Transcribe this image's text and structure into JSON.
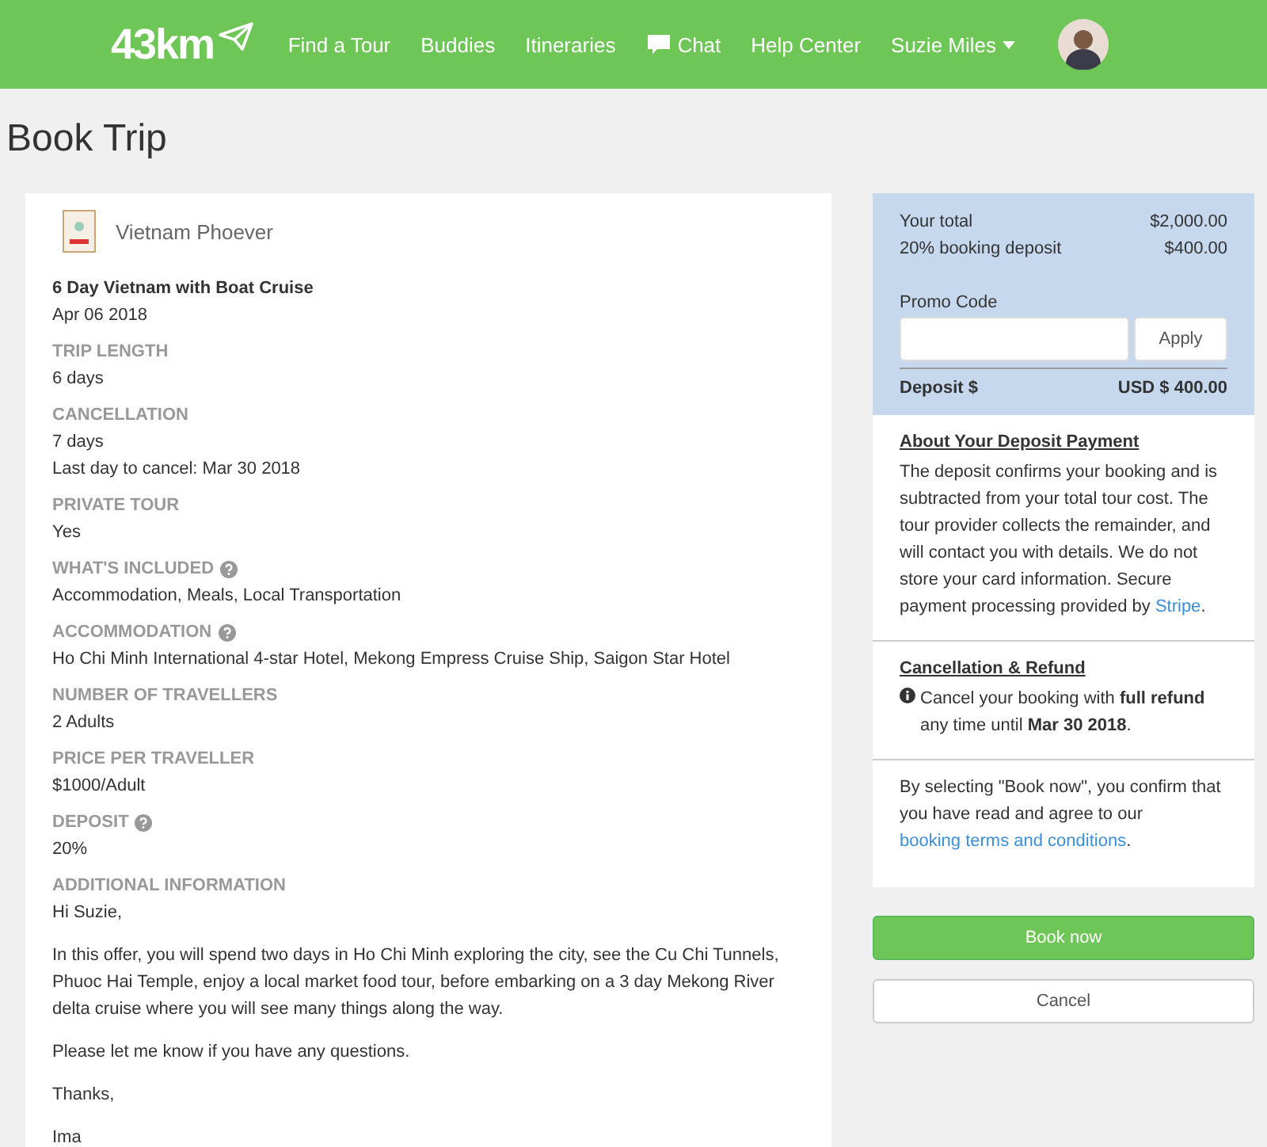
{
  "nav": {
    "logo": "43km",
    "links": [
      {
        "label": "Find a Tour",
        "kind": "text"
      },
      {
        "label": "Buddies",
        "kind": "text"
      },
      {
        "label": "Itineraries",
        "kind": "text"
      },
      {
        "label": "Chat",
        "kind": "chat"
      },
      {
        "label": "Help Center",
        "kind": "text"
      }
    ],
    "user": "Suzie Miles"
  },
  "page_title": "Book Trip",
  "trip": {
    "provider": "Vietnam Phoever",
    "name": "6 Day Vietnam with Boat Cruise",
    "date": "Apr 06 2018",
    "fields": [
      {
        "label": "TRIP LENGTH",
        "help": false,
        "values": [
          "6 days"
        ]
      },
      {
        "label": "CANCELLATION",
        "help": false,
        "values": [
          "7 days",
          "Last day to cancel: Mar 30 2018"
        ]
      },
      {
        "label": "PRIVATE TOUR",
        "help": false,
        "values": [
          "Yes"
        ]
      },
      {
        "label": "WHAT'S INCLUDED",
        "help": true,
        "values": [
          "Accommodation, Meals, Local Transportation"
        ]
      },
      {
        "label": "ACCOMMODATION",
        "help": true,
        "values": [
          "Ho Chi Minh International 4-star Hotel, Mekong Empress Cruise Ship, Saigon Star Hotel"
        ]
      },
      {
        "label": "NUMBER OF TRAVELLERS",
        "help": false,
        "values": [
          "2 Adults"
        ]
      },
      {
        "label": "PRICE PER TRAVELLER",
        "help": false,
        "values": [
          "$1000/Adult"
        ]
      },
      {
        "label": "DEPOSIT",
        "help": true,
        "values": [
          "20%"
        ]
      }
    ],
    "info_label": "ADDITIONAL INFORMATION",
    "info_paragraphs": [
      "Hi Suzie,",
      "In this offer, you will spend two days in Ho Chi Minh exploring the city, see the Cu Chi Tunnels, Phuoc Hai Temple, enjoy a local market food tour, before embarking on a 3 day Mekong River delta cruise where you will see many things along the way.",
      "Please let me know if you have any questions.",
      "Thanks,",
      "Ima"
    ]
  },
  "summary": {
    "lines": [
      {
        "label": "Your total",
        "value": "$2,000.00"
      },
      {
        "label": "20% booking deposit",
        "value": "$400.00"
      }
    ],
    "promo_label": "Promo Code",
    "apply": "Apply",
    "deposit_label": "Deposit $",
    "deposit_value": "USD $ 400.00"
  },
  "about": {
    "title": "About Your Deposit Payment",
    "text": "The deposit confirms your booking and is subtracted from your total tour cost. The tour provider collects the remainder, and will contact you with details. We do not store your card information. Secure payment processing provided by ",
    "link": "Stripe",
    "after": "."
  },
  "refund": {
    "title": "Cancellation & Refund",
    "text": "Cancel your booking with **full refund** any time until **Mar 30 2018**."
  },
  "terms": {
    "text": "By selecting \"Book now\", you confirm that you have read and agree to our ",
    "link": "booking terms and conditions",
    "after": "."
  },
  "buttons": {
    "book": "Book now",
    "cancel": "Cancel"
  }
}
